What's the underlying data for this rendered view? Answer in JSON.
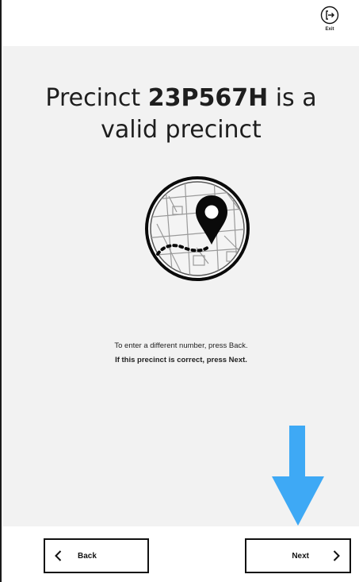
{
  "header": {
    "exit_label": "Exit",
    "exit_icon": "exit-icon"
  },
  "main": {
    "title_prefix": "Precinct ",
    "precinct_id": "23P567H",
    "title_suffix": " is a",
    "title_line2": "valid precinct",
    "illustration_icon": "map-pin-icon",
    "instruction_back": "To enter a different number, press Back.",
    "instruction_next": "If this precinct is correct, press Next.",
    "arrow_icon": "arrow-down-icon"
  },
  "footer": {
    "back_label": "Back",
    "next_label": "Next"
  },
  "colors": {
    "content_background": "#f2f2f2",
    "arrow": "#3ea9f5",
    "text": "#1e1e1e"
  }
}
